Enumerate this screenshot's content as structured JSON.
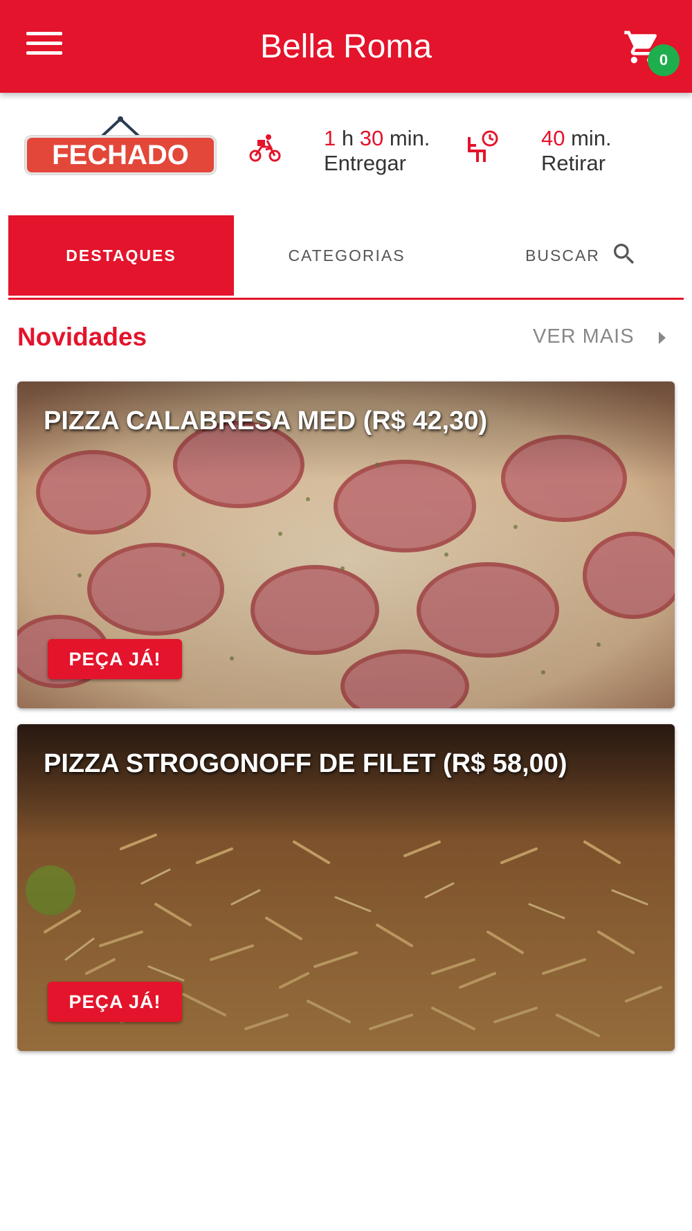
{
  "app": {
    "title": "Bella Roma",
    "cart_count": "0"
  },
  "status": {
    "sign": "FECHADO",
    "delivery": {
      "hours": "1",
      "h_label": "h",
      "minutes": "30",
      "min_label": "min.",
      "label": "Entregar",
      "icon": "delivery-motorcycle-icon"
    },
    "pickup": {
      "minutes": "40",
      "min_label": "min.",
      "label": "Retirar",
      "icon": "pickup-clock-icon"
    }
  },
  "tabs": [
    {
      "label": "DESTAQUES",
      "active": true
    },
    {
      "label": "CATEGORIAS",
      "active": false
    },
    {
      "label": "BUSCAR",
      "active": false
    }
  ],
  "section": {
    "title": "Novidades",
    "see_more": "VER MAIS"
  },
  "products": [
    {
      "name": "PIZZA CALABRESA MED (R$ 42,30)",
      "button": "PEÇA JÁ!"
    },
    {
      "name": "PIZZA STROGONOFF DE FILET (R$ 58,00)",
      "button": "PEÇA JÁ!"
    }
  ],
  "colors": {
    "brand": "#e3142b",
    "badge": "#1fae4d",
    "muted": "#888888"
  }
}
